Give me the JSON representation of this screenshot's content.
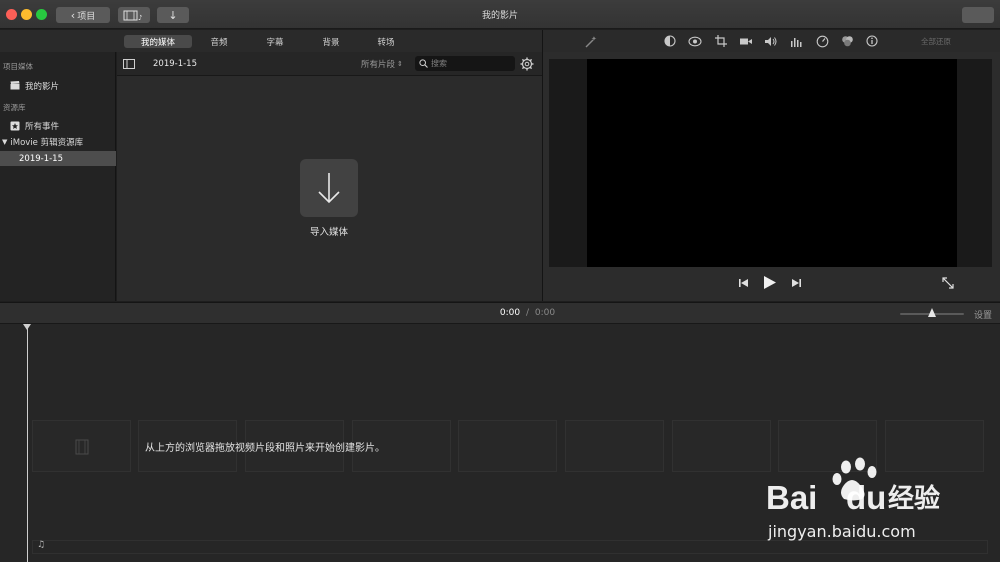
{
  "window": {
    "title": "我的影片",
    "back_label": "项目",
    "traffic_colors": [
      "#fc5f57",
      "#fdbc2e",
      "#28c840"
    ]
  },
  "browser_tabs": [
    {
      "label": "我的媒体",
      "active": true
    },
    {
      "label": "音频",
      "active": false
    },
    {
      "label": "字幕",
      "active": false
    },
    {
      "label": "背景",
      "active": false
    },
    {
      "label": "转场",
      "active": false
    }
  ],
  "sidebar": {
    "project_media_header": "项目媒体",
    "my_movie": "我的影片",
    "library_header": "资源库",
    "all_events": "所有事件",
    "library_name": "iMovie 剪辑资源库",
    "event": "2019-1-15"
  },
  "browser": {
    "event_title": "2019-1-15",
    "filter_label": "所有片段",
    "search_placeholder": "搜索",
    "import_label": "导入媒体"
  },
  "viewer": {
    "reset_all": "全部还原"
  },
  "timeline": {
    "current_time": "0:00",
    "separator": "/",
    "total_time": "0:00",
    "settings_label": "设置",
    "zoom_level": 0.5,
    "hint": "从上方的浏览器拖放视频片段和照片来开始创建影片。"
  },
  "watermark": {
    "brand": "Bai du 经验",
    "url": "jingyan.baidu.com"
  }
}
